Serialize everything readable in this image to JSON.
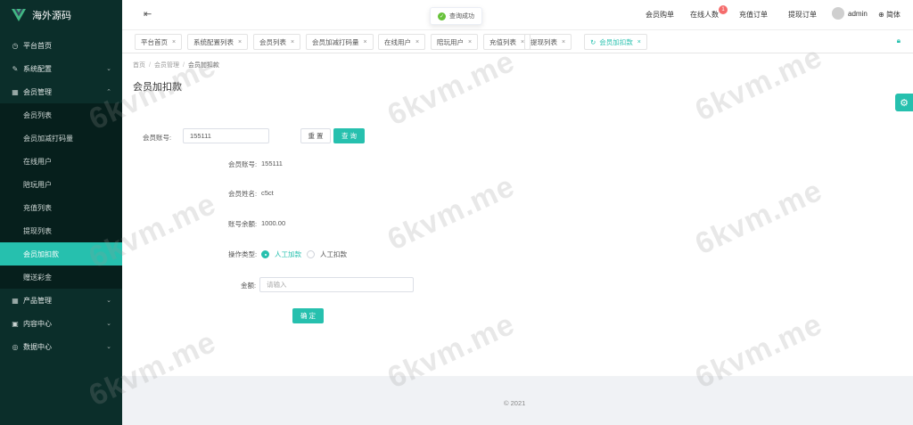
{
  "app": {
    "name": "海外源码"
  },
  "sidebar": {
    "items": [
      {
        "label": "平台首页",
        "icon": "clock-icon"
      },
      {
        "label": "系统配置",
        "icon": "edit-icon"
      },
      {
        "label": "会员管理",
        "icon": "grid-icon"
      },
      {
        "label": "产品管理",
        "icon": "grid-icon"
      },
      {
        "label": "内容中心",
        "icon": "square-icon"
      },
      {
        "label": "数据中心",
        "icon": "circle-icon"
      }
    ],
    "member_subitems": [
      {
        "label": "会员列表"
      },
      {
        "label": "会员加减打码量"
      },
      {
        "label": "在线用户"
      },
      {
        "label": "陪玩用户"
      },
      {
        "label": "充值列表"
      },
      {
        "label": "提现列表"
      },
      {
        "label": "会员加扣款"
      },
      {
        "label": "赠送彩金"
      }
    ]
  },
  "header": {
    "toast": "查询成功",
    "nav": {
      "member_buy": "会员购单",
      "online_count": "在线人数",
      "online_badge": "1",
      "recharge_orders": "充值订单",
      "withdraw_orders": "提现订单",
      "user": "admin",
      "lang": "简体"
    }
  },
  "tabs": [
    {
      "label": "平台首页"
    },
    {
      "label": "系统配置列表"
    },
    {
      "label": "会员列表"
    },
    {
      "label": "会员加减打码量"
    },
    {
      "label": "在线用户"
    },
    {
      "label": "陪玩用户"
    },
    {
      "label": "充值列表"
    },
    {
      "label": "提现列表"
    },
    {
      "label": "会员加扣款"
    }
  ],
  "breadcrumb": [
    "首页",
    "会员管理",
    "会员加扣款"
  ],
  "page": {
    "title": "会员加扣款",
    "search": {
      "label": "会员账号:",
      "value": "155111",
      "reset": "重 置",
      "query": "查 询"
    },
    "info": {
      "account_label": "会员账号:",
      "account_value": "155111",
      "name_label": "会员姓名:",
      "name_value": "c5ct",
      "balance_label": "账号余额:",
      "balance_value": "1000.00"
    },
    "operation": {
      "label": "操作类型:",
      "options": [
        "人工加款",
        "人工扣款"
      ],
      "selected": "人工加款"
    },
    "amount": {
      "label": "金额:",
      "placeholder": "请输入"
    },
    "confirm": "确 定"
  },
  "footer": {
    "copyright": "2021"
  },
  "watermark": "6kvm.me",
  "colors": {
    "accent": "#26c0ae",
    "sidebar_bg": "#0b2e2a",
    "badge": "#f56c6c"
  }
}
